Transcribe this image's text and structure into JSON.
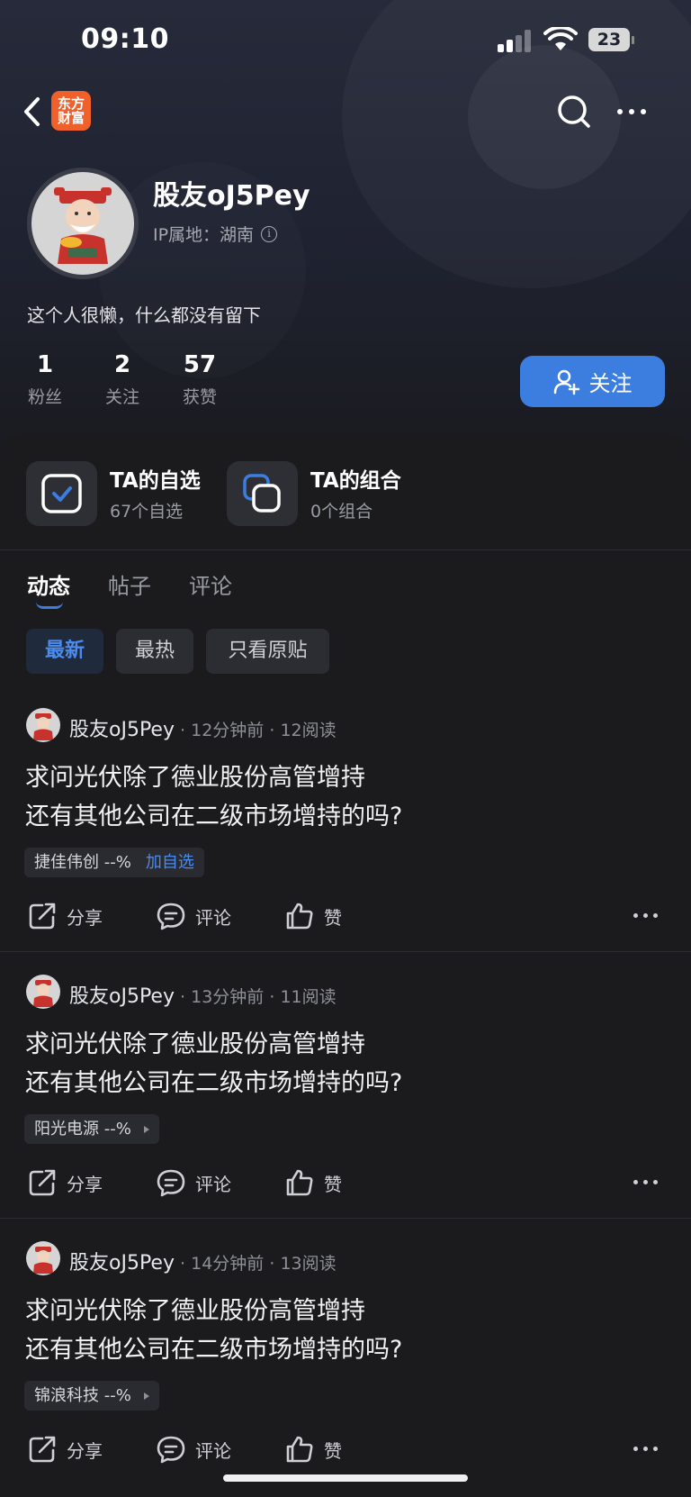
{
  "status_bar": {
    "time": "09:10",
    "battery": "23"
  },
  "nav": {
    "logo_line1": "东方",
    "logo_line2": "财富"
  },
  "profile": {
    "username": "股友oJ5Pey",
    "ip_location": "IP属地：湖南",
    "bio": "这个人很懒，什么都没有留下",
    "stats": [
      {
        "num": "1",
        "label": "粉丝"
      },
      {
        "num": "2",
        "label": "关注"
      },
      {
        "num": "57",
        "label": "获赞"
      }
    ],
    "follow_label": "关注"
  },
  "cards": {
    "watchlist": {
      "title": "TA的自选",
      "sub": "67个自选"
    },
    "portfolio": {
      "title": "TA的组合",
      "sub": "0个组合"
    }
  },
  "tabs": [
    "动态",
    "帖子",
    "评论"
  ],
  "filters": [
    "最新",
    "最热",
    "只看原贴"
  ],
  "posts": [
    {
      "author": "股友oJ5Pey",
      "time": "12分钟前",
      "reads": "12阅读",
      "line1": "求问光伏除了德业股份高管增持",
      "line2": "还有其他公司在二级市场增持的吗?",
      "tag": "捷佳伟创 --%",
      "tag_action": "加自选",
      "share": "分享",
      "comment": "评论",
      "like": "赞"
    },
    {
      "author": "股友oJ5Pey",
      "time": "13分钟前",
      "reads": "11阅读",
      "line1": "求问光伏除了德业股份高管增持",
      "line2": "还有其他公司在二级市场增持的吗?",
      "tag": "阳光电源 --%",
      "share": "分享",
      "comment": "评论",
      "like": "赞"
    },
    {
      "author": "股友oJ5Pey",
      "time": "14分钟前",
      "reads": "13阅读",
      "line1": "求问光伏除了德业股份高管增持",
      "line2": "还有其他公司在二级市场增持的吗?",
      "tag": "锦浪科技 --%",
      "share": "分享",
      "comment": "评论",
      "like": "赞"
    }
  ],
  "colors": {
    "accent": "#3c7de0",
    "logo": "#f0602a",
    "background": "#1b1b1d"
  }
}
